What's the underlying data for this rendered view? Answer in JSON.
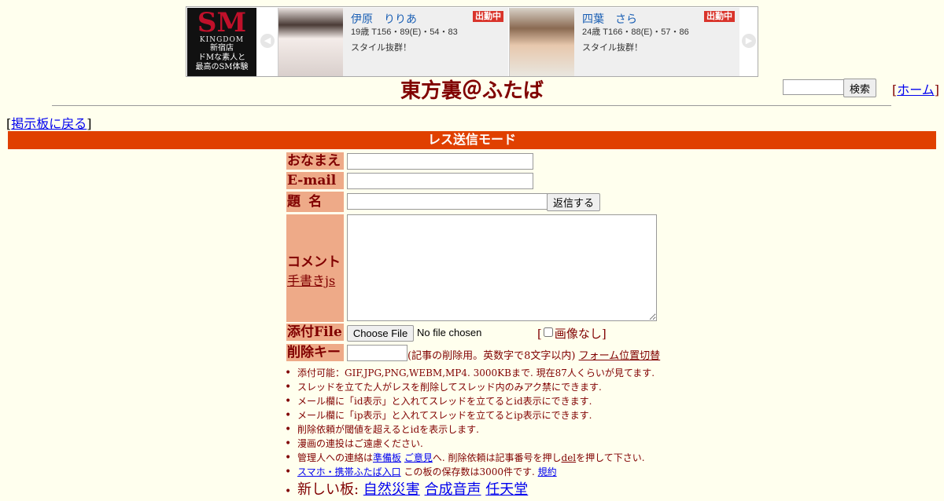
{
  "ad": {
    "logo_main": "SM",
    "logo_brand": "KINGDOM",
    "logo_lines": [
      "新宿店",
      "ドMな素人と",
      "最高のSM体験"
    ],
    "prev_icon": "chevron-left-icon",
    "next_icon": "chevron-right-icon",
    "cards": [
      {
        "name": "伊原　りりあ",
        "badge": "出勤中",
        "stats": "19歳 T156・89(E)・54・83",
        "desc": "スタイル抜群！"
      },
      {
        "name": "四葉　さら",
        "badge": "出勤中",
        "stats": "24歳 T166・88(E)・57・86",
        "desc": "スタイル抜群！"
      }
    ]
  },
  "header": {
    "title": "東方裏＠ふたば",
    "search_button": "検索",
    "home_link": "ホーム",
    "back_link": "掲示板に戻る"
  },
  "mode_label": "レス送信モード",
  "form": {
    "name_label": "おなまえ",
    "email_label": "E-mail",
    "subject_label": "題名",
    "reply_button": "返信する",
    "comment_label": "コメント",
    "handwrite_link": "手書きjs",
    "file_label": "添付File",
    "choose_file": "Choose File",
    "file_status": "No file chosen",
    "no_image_label": "画像なし",
    "delkey_label": "削除キー",
    "delkey_note": "(記事の削除用。英数字で8文字以内)",
    "form_switch_link": "フォーム位置切替"
  },
  "notes": {
    "n1": "添付可能：GIF,JPG,PNG,WEBM,MP4. 3000KBまで. 現在87人くらいが見てます.",
    "n2": "スレッドを立てた人がレスを削除してスレッド内のみアク禁にできます.",
    "n3": "メール欄に「id表示」と入れてスレッドを立てるとid表示にできます.",
    "n4": "メール欄に「ip表示」と入れてスレッドを立てるとip表示にできます.",
    "n5": "削除依頼が閾値を超えるとidを表示します.",
    "n6": "漫画の連投はご遠慮ください.",
    "n7_prefix": "管理人への連絡は",
    "n7_link1": "準備板",
    "n7_link2": "ご意見",
    "n7_mid": "へ. 削除依頼は記事番号を押し",
    "n7_link3": "del",
    "n7_suffix": "を押して下さい.",
    "n8_link1": "スマホ・携帯ふたば入口",
    "n8_mid": " この板の保存数は3000件です. ",
    "n8_link2": "規約",
    "n9_prefix": "新しい板: ",
    "n9_links": [
      "自然災害",
      "合成音声",
      "任天堂"
    ]
  }
}
